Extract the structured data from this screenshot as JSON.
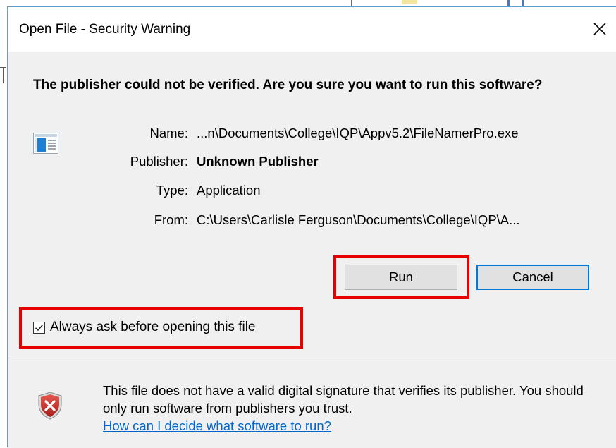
{
  "dialog": {
    "title": "Open File - Security Warning",
    "close_icon": "close-icon",
    "question": "The publisher could not be verified.  Are you sure you want to run this software?",
    "details": [
      {
        "label": "Name:",
        "value": "...n\\Documents\\College\\IQP\\Appv5.2\\FileNamerPro.exe",
        "bold": false
      },
      {
        "label": "Publisher:",
        "value": "Unknown Publisher",
        "bold": true
      },
      {
        "label": "Type:",
        "value": "Application",
        "bold": false
      },
      {
        "label": "From:",
        "value": "C:\\Users\\Carlisle Ferguson\\Documents\\College\\IQP\\A...",
        "bold": false
      }
    ],
    "buttons": {
      "run_label": "Run",
      "cancel_label": "Cancel"
    },
    "always_ask": {
      "label": "Always ask before opening this file",
      "checked": true
    },
    "warning": {
      "text": "This file does not have a valid digital signature that verifies its publisher.  You should only run software from publishers you trust.",
      "link": "How can I decide what software to run?"
    },
    "colors": {
      "highlight": "#e60000",
      "accent": "#0078d7",
      "link": "#0066cc",
      "shield": "#c9302c"
    }
  }
}
